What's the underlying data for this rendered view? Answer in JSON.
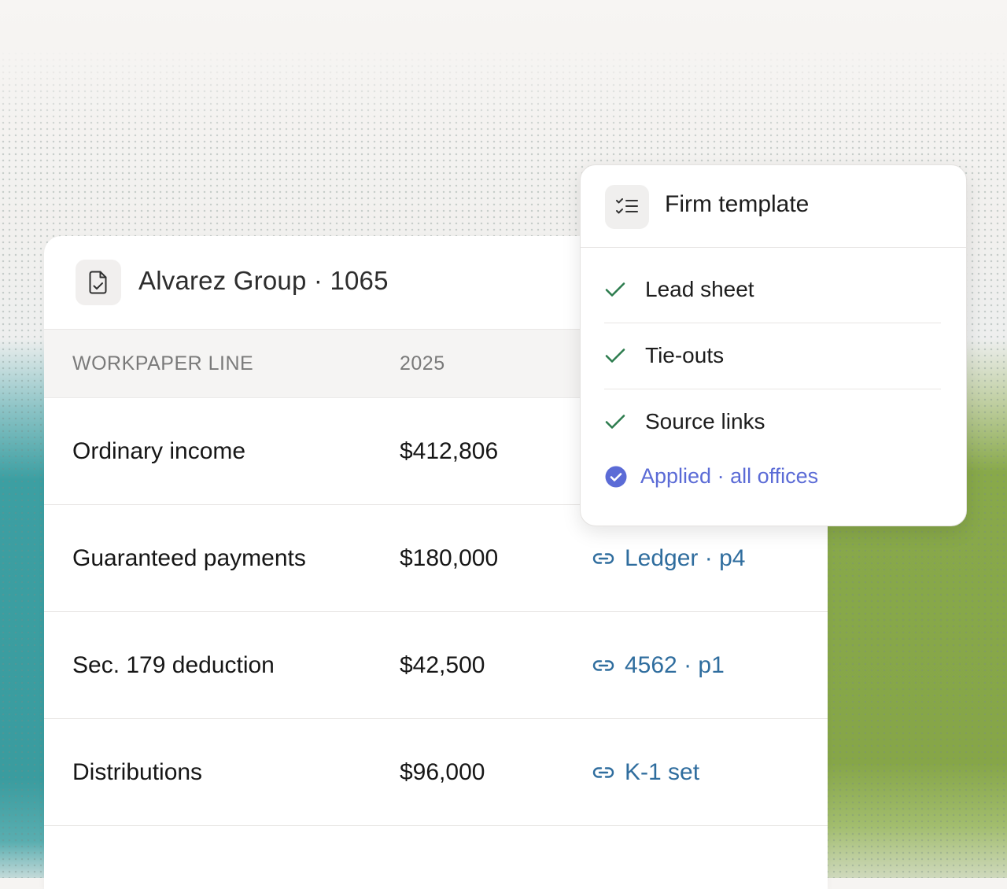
{
  "card": {
    "title": "Alvarez Group · 1065",
    "columns": [
      "WORKPAPER LINE",
      "2025"
    ],
    "rows": [
      {
        "line": "Ordinary income",
        "amount": "$412,806",
        "source": ""
      },
      {
        "line": "Guaranteed payments",
        "amount": "$180,000",
        "source": "Ledger · p4"
      },
      {
        "line": "Sec. 179 deduction",
        "amount": "$42,500",
        "source": "4562 · p1"
      },
      {
        "line": "Distributions",
        "amount": "$96,000",
        "source": "K-1 set"
      }
    ]
  },
  "popover": {
    "title": "Firm template",
    "items": [
      "Lead sheet",
      "Tie-outs",
      "Source links"
    ],
    "status": "Applied · all offices"
  },
  "icons": {
    "card_header": "document-check-icon",
    "popover_header": "checklist-icon",
    "source": "link-icon",
    "check": "check-icon",
    "status": "check-circle-icon"
  },
  "colors": {
    "link": "#2f6d9e",
    "check": "#2e7d4f",
    "applied": "#5b6bd6",
    "teal_band": "#3c9fa2",
    "green_band": "#88a94a"
  }
}
